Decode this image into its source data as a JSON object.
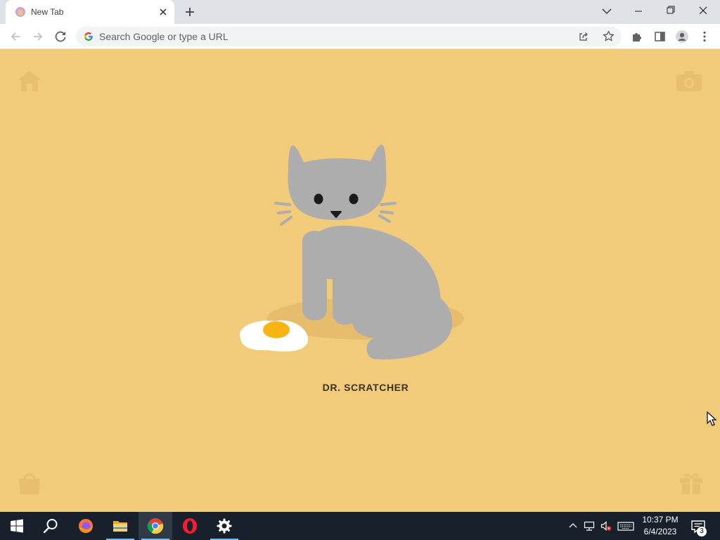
{
  "browser": {
    "tab": {
      "title": "New Tab"
    },
    "omnibox": {
      "placeholder": "Search Google or type a URL"
    }
  },
  "page": {
    "pet_name": "DR. SCRATCHER"
  },
  "taskbar": {
    "time": "10:37 PM",
    "date": "6/4/2023",
    "notification_count": "3"
  },
  "colors": {
    "page_background": "#f1cb7a",
    "cat": "#adadad",
    "taskbar": "#18212b"
  },
  "icons": [
    "home-icon",
    "camera-icon",
    "bag-icon",
    "gift-icon",
    "chrome-icon",
    "firefox-icon",
    "opera-icon",
    "settings-icon"
  ]
}
